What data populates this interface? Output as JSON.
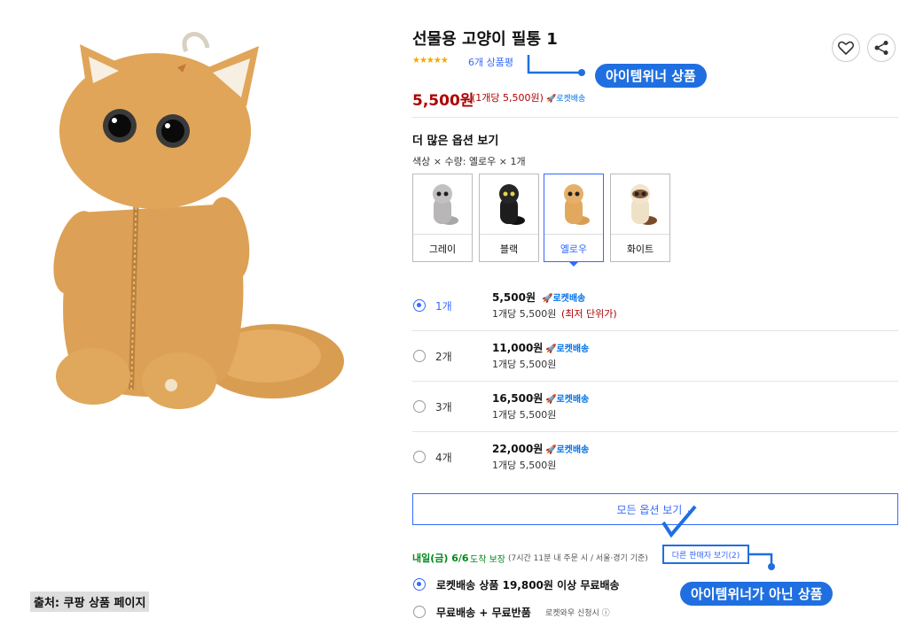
{
  "product": {
    "title": "선물용 고양이 필통 1",
    "stars": "★★★★★",
    "review_count": "6개 상품평",
    "price": "5,500원",
    "unit_price": "(1개당 5,500원)",
    "rocket_small": "🚀로켓배송"
  },
  "options": {
    "heading": "더 많은 옵션 보기",
    "selection_summary": "색상 × 수량: 옐로우 × 1개",
    "colors": [
      {
        "label": "그레이",
        "hex": "#b9b6b8"
      },
      {
        "label": "블랙",
        "hex": "#1d1d1d"
      },
      {
        "label": "옐로우",
        "hex": "#e2a95e"
      },
      {
        "label": "화이트",
        "hex": "#efe1c6"
      }
    ],
    "selected_color": "옐로우"
  },
  "quantities": [
    {
      "qty": "1개",
      "total": "5,500원",
      "rocket": "🚀로켓배송",
      "per": "1개당 5,500원",
      "note": "(최저 단위가)",
      "selected": true
    },
    {
      "qty": "2개",
      "total": "11,000원",
      "rocket": "🚀로켓배송",
      "per": "1개당 5,500원",
      "selected": false
    },
    {
      "qty": "3개",
      "total": "16,500원",
      "rocket": "🚀로켓배송",
      "per": "1개당 5,500원",
      "selected": false
    },
    {
      "qty": "4개",
      "total": "22,000원",
      "rocket": "🚀로켓배송",
      "per": "1개당 5,500원",
      "selected": false
    }
  ],
  "all_options_button": "모든 옵션 보기",
  "delivery": {
    "date": "내일(금) 6/6",
    "guarantee": "도착 보장",
    "note": "(7시간 11분 내 주문 시 / 서울⋅경기 기준)",
    "other_sellers": "다른 판매자 보기(2)"
  },
  "shipping": [
    {
      "label": "로켓배송 상품 19,800원 이상 무료배송",
      "sub": "",
      "selected": true
    },
    {
      "label": "무료배송 + 무료반품",
      "sub": "로켓와우 신청시 ⓘ",
      "selected": false
    }
  ],
  "annotations": {
    "item_winner": "아이템위너 상품",
    "not_item_winner": "아이템위너가 아닌 상품"
  },
  "caption": "출처: 쿠팡 상품 페이지",
  "colors": {
    "accent": "#346aff",
    "price_red": "#ae0000",
    "rocket_blue": "#0073e9",
    "delivery_green": "#00891a",
    "callout_blue": "#1f6fe0",
    "product_fur": "#e2a95e"
  }
}
